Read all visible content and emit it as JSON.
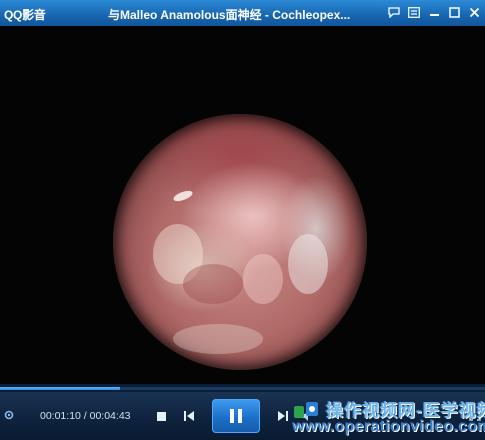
{
  "titlebar": {
    "app_name": "QQ影音",
    "window_title": "与Malleo Anamolous面神经 - Cochleopex..."
  },
  "playback": {
    "time_text": "00:01:10 / 00:04:43",
    "progress": 0.247
  },
  "watermark": {
    "line1": "操作视频网-医学视频",
    "line2": "www.operationvideo.com"
  }
}
